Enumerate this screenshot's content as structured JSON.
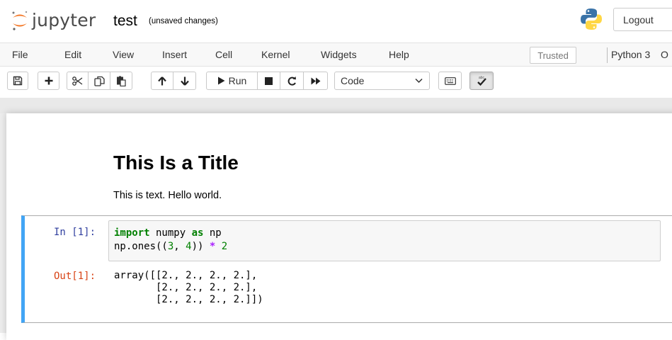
{
  "header": {
    "logo_text": "jupyter",
    "notebook_name": "test",
    "save_status": "(unsaved changes)",
    "logout_label": "Logout"
  },
  "menubar": {
    "items": [
      "File",
      "Edit",
      "View",
      "Insert",
      "Cell",
      "Kernel",
      "Widgets",
      "Help"
    ],
    "trusted_label": "Trusted",
    "kernel_name": "Python 3",
    "kernel_indicator": "O"
  },
  "toolbar": {
    "icons": [
      "save-icon",
      "plus-icon",
      "cut-icon",
      "copy-icon",
      "paste-icon",
      "arrow-up-icon",
      "arrow-down-icon",
      "play-icon",
      "stop-icon",
      "restart-icon",
      "fast-forward-icon",
      "keyboard-icon",
      "spellcheck-icon"
    ],
    "run_label": "Run",
    "cell_type": "Code"
  },
  "cells": {
    "markdown": {
      "title": "This Is a Title",
      "text": "This is text. Hello world."
    },
    "code": {
      "in_prompt": "In [1]:",
      "out_prompt": "Out[1]:",
      "line1": {
        "kw1": "import",
        "mid": " numpy ",
        "kw2": "as",
        "end": " np"
      },
      "line2": {
        "a": "np.ones((",
        "n1": "3",
        "b": ", ",
        "n2": "4",
        "c": ")) ",
        "op": "*",
        "d": " ",
        "n3": "2"
      },
      "output_lines": [
        "array([[2., 2., 2., 2.],",
        "       [2., 2., 2., 2.],",
        "       [2., 2., 2., 2.]])"
      ]
    }
  },
  "colors": {
    "selected_cell_border": "#42a5f5",
    "in_prompt": "#303f9f",
    "out_prompt": "#d84315",
    "keyword": "#008000",
    "operator": "#aa22ff"
  }
}
